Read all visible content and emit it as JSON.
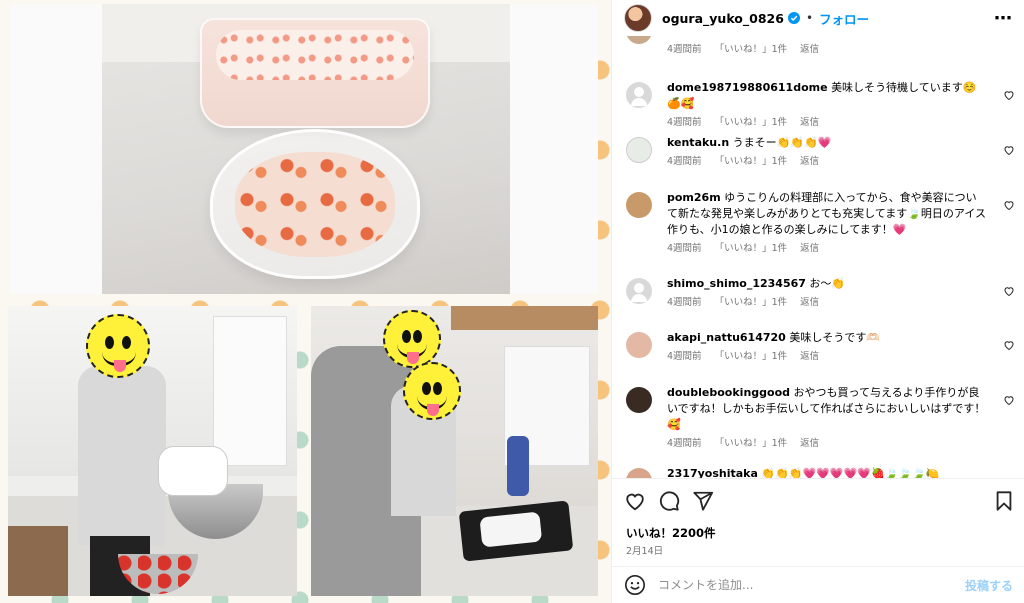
{
  "post": {
    "username": "ogura_yuko_0826",
    "follow_label": "フォロー",
    "dot": "•"
  },
  "comments": [
    {
      "user": "",
      "text": "",
      "time": "4週間前",
      "likes": "「いいね！」1件",
      "reply": "返信"
    },
    {
      "user": "dome198719880611dome",
      "text": "美味しそう待機しています☺️🍊🥰",
      "time": "4週間前",
      "likes": "「いいね！」1件",
      "reply": "返信"
    },
    {
      "user": "kentaku.n",
      "text": "うまそー👏👏👏💗",
      "time": "4週間前",
      "likes": "「いいね！」1件",
      "reply": "返信"
    },
    {
      "user": "pom26m",
      "text": "ゆうこりんの料理部に入ってから、食や美容について新たな発見や楽しみがありとても充実してます🍃明日のアイス作りも、小1の娘と作るの楽しみにしてます！💗",
      "time": "4週間前",
      "likes": "「いいね！」1件",
      "reply": "返信"
    },
    {
      "user": "shimo_shimo_1234567",
      "text": "お〜👏",
      "time": "4週間前",
      "likes": "「いいね！」1件",
      "reply": "返信"
    },
    {
      "user": "akapi_nattu614720",
      "text": "美味しそうです🫶🏻",
      "time": "4週間前",
      "likes": "「いいね！」1件",
      "reply": "返信"
    },
    {
      "user": "doublebookinggood",
      "text": "おやつも買って与えるより手作りが良いですね！しかもお手伝いして作ればさらにおいしいはずです！🥰",
      "time": "4週間前",
      "likes": "「いいね！」1件",
      "reply": "返信"
    },
    {
      "user": "2317yoshitaka",
      "text": "👏👏👏💗💗💗💗💗🍓🍃🍃🍃🍋",
      "time": "",
      "likes": "",
      "reply": ""
    }
  ],
  "stats": {
    "likes": "いいね！2200件",
    "date": "2月14日"
  },
  "comment_input": {
    "placeholder": "コメントを追加...",
    "post_label": "投稿する"
  },
  "icons": {
    "verified": "verified-badge-icon",
    "more": "more-options-icon",
    "like": "heart-icon",
    "comment": "comment-icon",
    "share": "share-icon",
    "save": "bookmark-icon",
    "emoji": "emoji-icon"
  },
  "colors": {
    "accent": "#0095f6",
    "post_disabled": "#9cd1fb",
    "meta_text": "#737373"
  }
}
